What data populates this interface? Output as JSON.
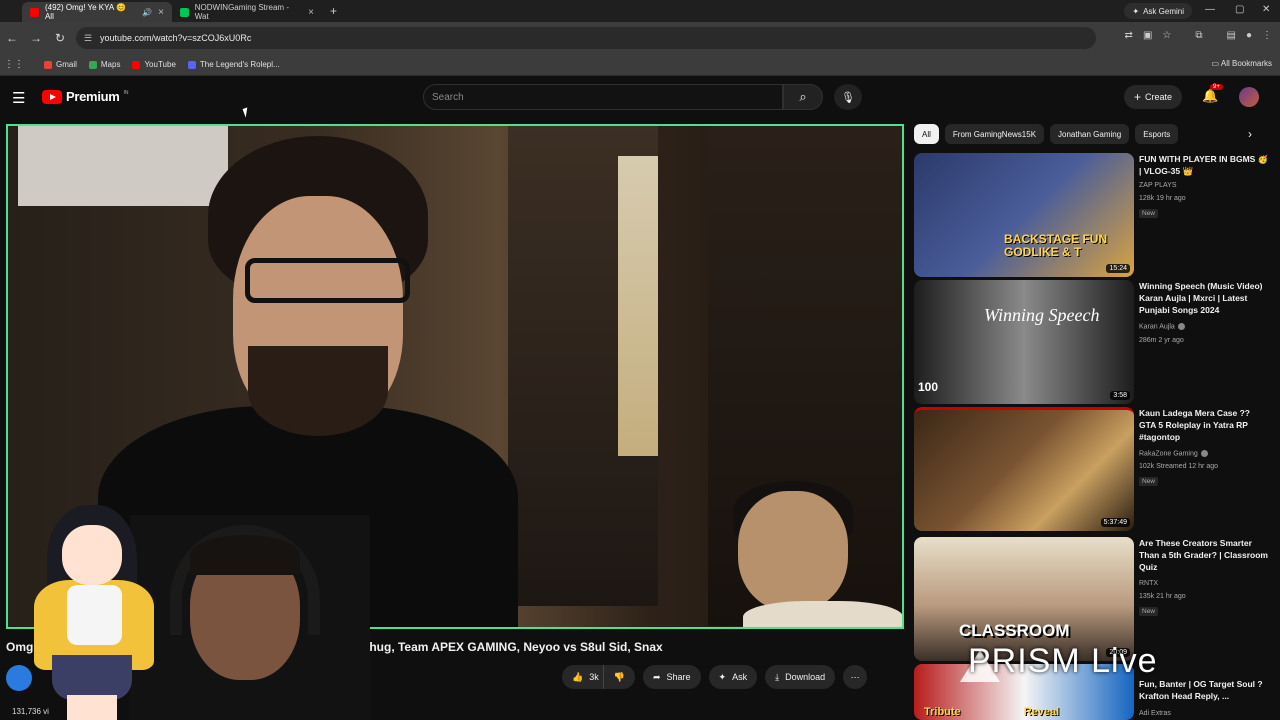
{
  "browser": {
    "tabs": [
      {
        "title": "(492) Omg! Ye KYA 😊 All",
        "active": true,
        "favicon_color": "#ff0000"
      },
      {
        "title": "NODWINGaming Stream - Wat",
        "active": false,
        "favicon_color": "#00c853"
      }
    ],
    "ask_gemini": "Ask Gemini",
    "url": "youtube.com/watch?v=szCOJ6xU0Rc",
    "bookmarks": [
      {
        "label": "Gmail",
        "color": "#ea4335"
      },
      {
        "label": "Maps",
        "color": "#34a853"
      },
      {
        "label": "YouTube",
        "color": "#ff0000"
      },
      {
        "label": "The Legend's Rolepl...",
        "color": "#5865f2"
      }
    ],
    "all_bookmarks": "All Bookmarks"
  },
  "header": {
    "brand": "Premium",
    "region": "IN",
    "search_placeholder": "Search",
    "create_label": "Create",
    "notif_count": "9+"
  },
  "video": {
    "title_prefix": "Omg",
    "title_suffix": "8Bit Thug, Team APEX GAMING, Neyoo vs S8ul Sid, Snax",
    "views": "131,736 vi",
    "likes": "3k",
    "share_label": "Share",
    "ask_label": "Ask",
    "download_label": "Download"
  },
  "chips": [
    "All",
    "From GamingNews15K",
    "Jonathan Gaming",
    "Esports"
  ],
  "recommendations": [
    {
      "title": "FUN WITH PLAYER IN BGMS 🥳 | VLOG-35 👑",
      "channel": "ZAP PLAYS",
      "meta": "128k  19 hr ago",
      "badge": "New",
      "duration": "15:24",
      "thumb_colors": [
        "#2b3a6a",
        "#d9a441"
      ],
      "overlay_text": "BACKSTAGE FUN GODLIKE & T"
    },
    {
      "title": "Winning Speech (Music Video) Karan Aujla | Mxrci | Latest Punjabi Songs 2024",
      "channel": "Karan Aujla",
      "meta": "286m  2 yr ago",
      "badge": "",
      "duration": "3:58",
      "thumb_colors": [
        "#2a2a2a",
        "#8a8a8a"
      ],
      "overlay_text": "Winning Speech"
    },
    {
      "title": "Kaun Ladega Mera Case ?? GTA 5 Roleplay in Yatra RP #tagontop",
      "channel": "RakaZone Gaming",
      "meta": "102k  Streamed 12 hr ago",
      "badge": "New",
      "duration": "5:37:49",
      "thumb_colors": [
        "#5a3a22",
        "#c8a060"
      ],
      "overlay_text": ""
    },
    {
      "title": "Are These Creators Smarter Than a 5th Grader? | Classroom Quiz",
      "channel": "RNTX",
      "meta": "135k  21 hr ago",
      "badge": "New",
      "duration": "20:09",
      "thumb_colors": [
        "#e8dfc9",
        "#3a2f28"
      ],
      "overlay_text": "CLASSROOM"
    },
    {
      "title": "Fun, Banter | OG Target Soul ? Krafton Head Reply, ...",
      "channel": "Adi Extras",
      "meta": "",
      "badge": "",
      "duration": "",
      "thumb_colors": [
        "#b71c1c",
        "#1565c0"
      ],
      "overlay_text": "Tribute Reveal"
    }
  ],
  "overlay": {
    "prism_text": "PRISM Live"
  }
}
